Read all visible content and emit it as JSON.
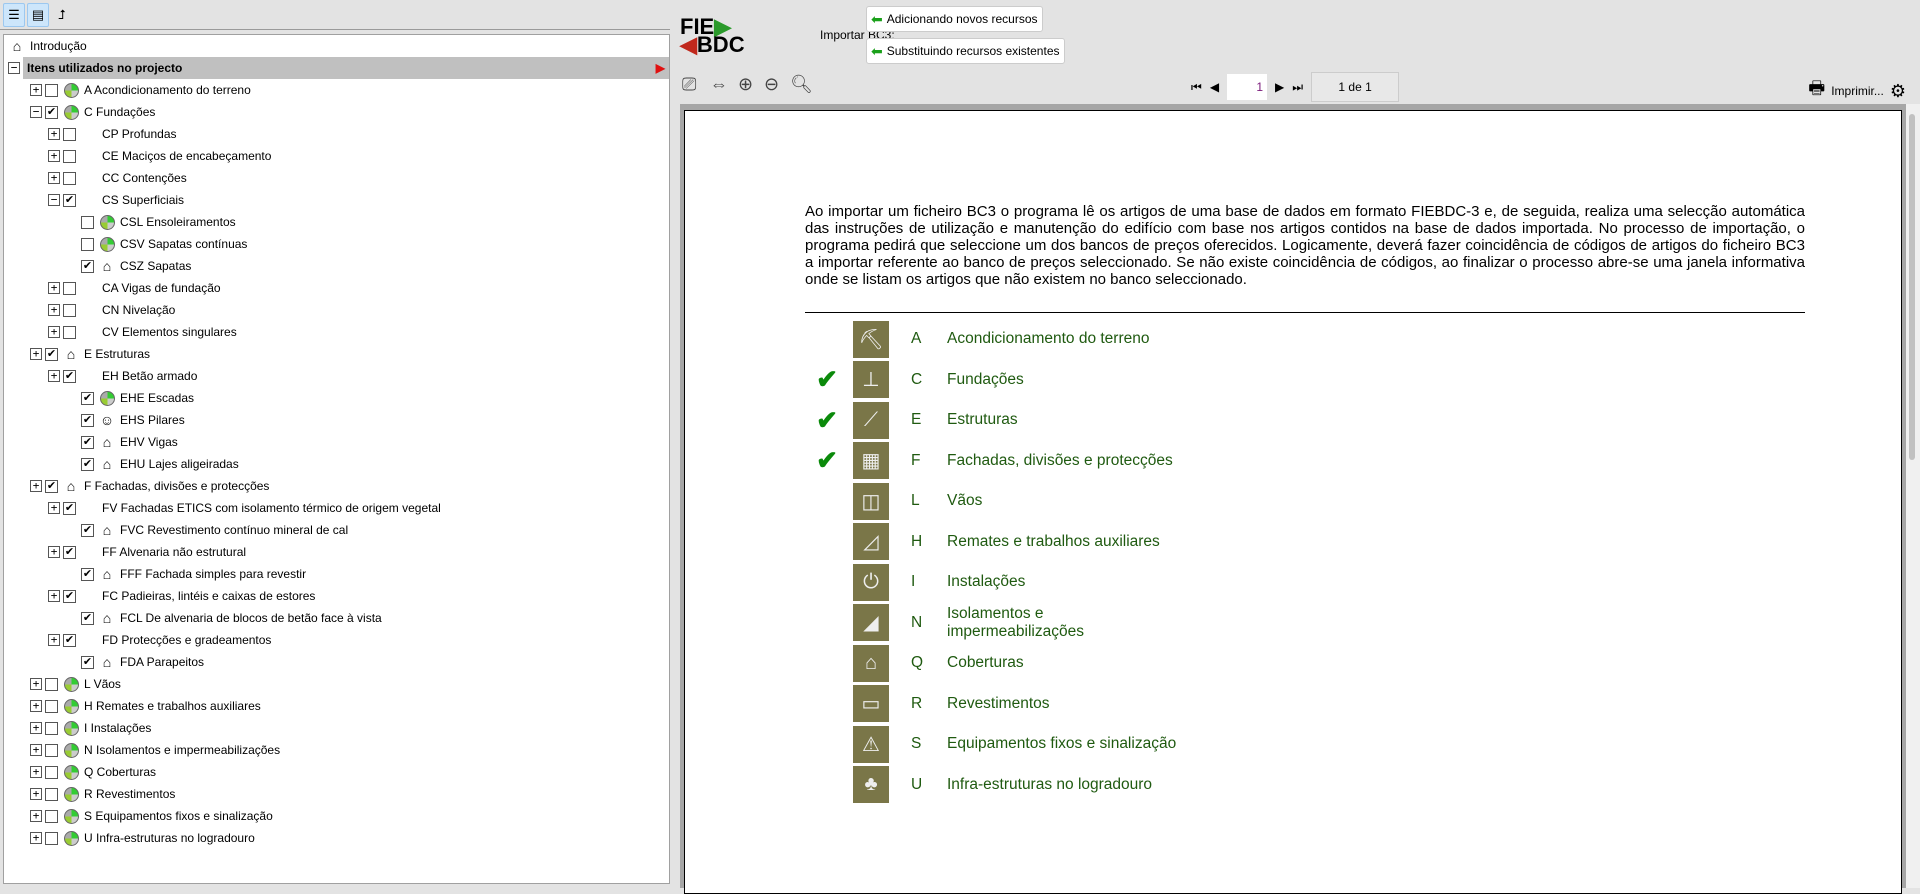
{
  "tree": {
    "intro": "Introdução",
    "header": "Itens utilizados no projecto",
    "rows": [
      {
        "level": 1,
        "exp": "+",
        "checked": false,
        "icon": "disc",
        "label": "A Acondicionamento do terreno"
      },
      {
        "level": 1,
        "exp": "-",
        "checked": true,
        "icon": "disc",
        "label": "C Fundações"
      },
      {
        "level": 2,
        "exp": "+",
        "checked": false,
        "icon": "",
        "label": "CP Profundas"
      },
      {
        "level": 2,
        "exp": "+",
        "checked": false,
        "icon": "",
        "label": "CE Maciços de encabeçamento"
      },
      {
        "level": 2,
        "exp": "+",
        "checked": false,
        "icon": "",
        "label": "CC Contenções"
      },
      {
        "level": 2,
        "exp": "-",
        "checked": true,
        "icon": "",
        "label": "CS Superficiais"
      },
      {
        "level": 3,
        "exp": "",
        "checked": false,
        "icon": "disc",
        "label": "CSL Ensoleiramentos"
      },
      {
        "level": 3,
        "exp": "",
        "checked": false,
        "icon": "disc",
        "label": "CSV Sapatas contínuas"
      },
      {
        "level": 3,
        "exp": "",
        "checked": true,
        "icon": "house",
        "label": "CSZ Sapatas"
      },
      {
        "level": 2,
        "exp": "+",
        "checked": false,
        "icon": "",
        "label": "CA Vigas de fundação"
      },
      {
        "level": 2,
        "exp": "+",
        "checked": false,
        "icon": "",
        "label": "CN Nivelação"
      },
      {
        "level": 2,
        "exp": "+",
        "checked": false,
        "icon": "",
        "label": "CV Elementos singulares"
      },
      {
        "level": 1,
        "exp": "+",
        "checked": true,
        "icon": "house",
        "label": "E Estruturas"
      },
      {
        "level": 2,
        "exp": "+",
        "checked": true,
        "icon": "",
        "label": "EH Betão armado"
      },
      {
        "level": 3,
        "exp": "",
        "checked": true,
        "icon": "disc",
        "label": "EHE Escadas"
      },
      {
        "level": 3,
        "exp": "",
        "checked": true,
        "icon": "person",
        "label": "EHS Pilares"
      },
      {
        "level": 3,
        "exp": "",
        "checked": true,
        "icon": "house",
        "label": "EHV Vigas"
      },
      {
        "level": 3,
        "exp": "",
        "checked": true,
        "icon": "house",
        "label": "EHU Lajes aligeiradas"
      },
      {
        "level": 1,
        "exp": "+",
        "checked": true,
        "icon": "house",
        "label": "F Fachadas, divisões e protecções"
      },
      {
        "level": 2,
        "exp": "+",
        "checked": true,
        "icon": "",
        "label": "FV Fachadas ETICS com isolamento térmico de origem vegetal"
      },
      {
        "level": 3,
        "exp": "",
        "checked": true,
        "icon": "house",
        "label": "FVC Revestimento contínuo mineral de cal"
      },
      {
        "level": 2,
        "exp": "+",
        "checked": true,
        "icon": "",
        "label": "FF Alvenaria não estrutural"
      },
      {
        "level": 3,
        "exp": "",
        "checked": true,
        "icon": "house",
        "label": "FFF Fachada simples para revestir"
      },
      {
        "level": 2,
        "exp": "+",
        "checked": true,
        "icon": "",
        "label": "FC Padieiras, lintéis e caixas de estores"
      },
      {
        "level": 3,
        "exp": "",
        "checked": true,
        "icon": "house",
        "label": "FCL De alvenaria de blocos de betão face à vista"
      },
      {
        "level": 2,
        "exp": "+",
        "checked": true,
        "icon": "",
        "label": "FD Protecções e gradeamentos"
      },
      {
        "level": 3,
        "exp": "",
        "checked": true,
        "icon": "house",
        "label": "FDA Parapeitos"
      },
      {
        "level": 1,
        "exp": "+",
        "checked": false,
        "icon": "disc",
        "label": "L Vãos"
      },
      {
        "level": 1,
        "exp": "+",
        "checked": false,
        "icon": "disc",
        "label": "H Remates e trabalhos auxiliares"
      },
      {
        "level": 1,
        "exp": "+",
        "checked": false,
        "icon": "disc",
        "label": "I Instalações"
      },
      {
        "level": 1,
        "exp": "+",
        "checked": false,
        "icon": "disc",
        "label": "N Isolamentos e impermeabilizações"
      },
      {
        "level": 1,
        "exp": "+",
        "checked": false,
        "icon": "disc",
        "label": "Q Coberturas"
      },
      {
        "level": 1,
        "exp": "+",
        "checked": false,
        "icon": "disc",
        "label": "R Revestimentos"
      },
      {
        "level": 1,
        "exp": "+",
        "checked": false,
        "icon": "disc",
        "label": "S Equipamentos fixos e sinalização"
      },
      {
        "level": 1,
        "exp": "+",
        "checked": false,
        "icon": "disc",
        "label": "U Infra-estruturas no logradouro"
      }
    ]
  },
  "header": {
    "logo_top": "FIE",
    "logo_bottom": "BDC",
    "import_label": "Importar BC3:",
    "add_button": "Adicionando novos recursos",
    "replace_button": "Substituindo recursos existentes"
  },
  "viewer": {
    "page_input": "1",
    "page_of": "1 de 1",
    "print_label": "Imprimir..."
  },
  "document": {
    "intro": "Ao importar um ficheiro BC3 o programa lê os artigos de uma base de dados em formato FIEBDC-3 e, de seguida, realiza uma selecção automática das instruções de utilização e manutenção do edifício com base nos artigos contidos na base de dados importada. No processo de importação, o programa pedirá que seleccione um dos bancos de preços oferecidos. Logicamente, deverá fazer coincidência de códigos de artigos do ficheiro BC3 a importar referente ao banco de preços seleccionado. Se não existe coincidência de códigos, ao finalizar o processo abre-se uma janela informativa onde se listam os artigos que não existem no banco seleccionado.",
    "check_color": "#0b8a0b",
    "icon_color": "#7a7648",
    "categories": [
      {
        "letter": "A",
        "label": "Acondicionamento do terreno",
        "checked": false,
        "icon": "excavator"
      },
      {
        "letter": "C",
        "label": "Fundações",
        "checked": true,
        "icon": "foundation"
      },
      {
        "letter": "E",
        "label": "Estruturas",
        "checked": true,
        "icon": "structure"
      },
      {
        "letter": "F",
        "label": "Fachadas, divisões e protecções",
        "checked": true,
        "icon": "building"
      },
      {
        "letter": "L",
        "label": "Vãos",
        "checked": false,
        "icon": "window"
      },
      {
        "letter": "H",
        "label": "Remates e trabalhos auxiliares",
        "checked": false,
        "icon": "trowel"
      },
      {
        "letter": "I",
        "label": "Instalações",
        "checked": false,
        "icon": "plug"
      },
      {
        "letter": "N",
        "label": "Isolamentos e impermeabilizações",
        "checked": false,
        "icon": "insulation"
      },
      {
        "letter": "Q",
        "label": "Coberturas",
        "checked": false,
        "icon": "roof"
      },
      {
        "letter": "R",
        "label": "Revestimentos",
        "checked": false,
        "icon": "roller"
      },
      {
        "letter": "S",
        "label": "Equipamentos fixos e sinalização",
        "checked": false,
        "icon": "signs"
      },
      {
        "letter": "U",
        "label": "Infra-estruturas no logradouro",
        "checked": false,
        "icon": "tree"
      }
    ]
  }
}
